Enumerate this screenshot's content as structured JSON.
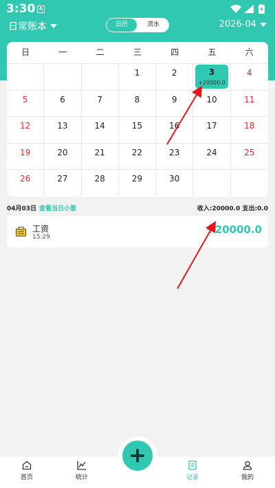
{
  "status_bar": {
    "time": "3:30",
    "app_badge": "A",
    "icons": [
      "wifi-icon",
      "signal-icon",
      "battery-charging-icon"
    ]
  },
  "header": {
    "book_name": "日常账本",
    "toggle": {
      "calendar_label": "日历",
      "flow_label": "流水",
      "active": "calendar"
    },
    "month": "2026-04"
  },
  "calendar": {
    "weekdays": [
      "日",
      "一",
      "二",
      "三",
      "四",
      "五",
      "六"
    ],
    "weeks": [
      [
        "",
        "",
        "",
        "1",
        "2",
        "3",
        "4"
      ],
      [
        "5",
        "6",
        "7",
        "8",
        "9",
        "10",
        "11"
      ],
      [
        "12",
        "13",
        "14",
        "15",
        "16",
        "17",
        "18"
      ],
      [
        "19",
        "20",
        "21",
        "22",
        "23",
        "24",
        "25"
      ],
      [
        "26",
        "27",
        "28",
        "29",
        "30",
        "",
        ""
      ]
    ],
    "selected_day": "3",
    "selected_amount": "+20000.0",
    "weekend_color": "#e0282e",
    "accent_color": "#30c8b0"
  },
  "summary": {
    "date": "04月03日",
    "receipt_link": "查看当日小票",
    "totals": "收入:20000.0  支出:0.0"
  },
  "records": [
    {
      "icon": "wallet-icon",
      "title": "工资",
      "time": "15:29",
      "amount": "+20000.0"
    }
  ],
  "tabbar": {
    "home": "首页",
    "stats": "统计",
    "records": "记录",
    "mine": "我的",
    "active": "records"
  }
}
